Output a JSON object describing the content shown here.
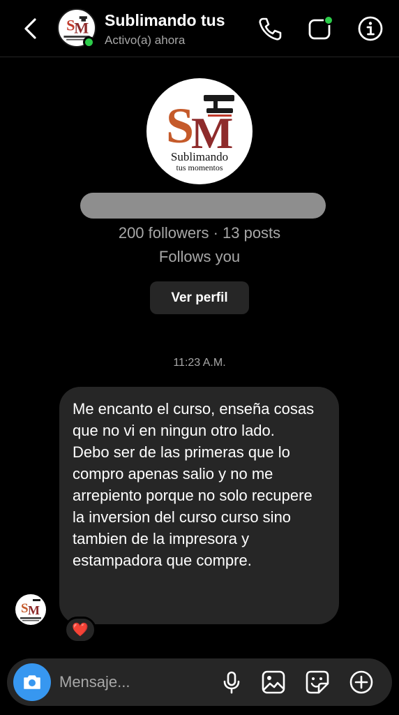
{
  "header": {
    "title": "Sublimando tus",
    "status": "Activo(a) ahora"
  },
  "profile": {
    "logo_initials": "SM",
    "logo_line1": "Sublimando",
    "logo_line2": "tus momentos",
    "stats": "200 followers · 13 posts",
    "follows": "Follows you",
    "view_profile_label": "Ver perfil"
  },
  "chat": {
    "timestamp": "11:23 A.M.",
    "message": "Me encanto el curso, enseña cosas que no vi en ningun otro lado.\nDebo ser de las primeras que lo compro apenas salio y no me arrepiento porque no solo recupere la inversion del curso curso sino tambien de la impresora y estampadora que compre.",
    "reaction": "❤️"
  },
  "composer": {
    "placeholder": "Mensaje..."
  },
  "colors": {
    "online": "#2dcc4a",
    "accent": "#3797f0",
    "bubble": "#262626"
  },
  "icons": [
    "back-chevron-icon",
    "phone-icon",
    "video-icon",
    "info-icon",
    "camera-icon",
    "microphone-icon",
    "gallery-icon",
    "sticker-icon",
    "plus-icon"
  ]
}
